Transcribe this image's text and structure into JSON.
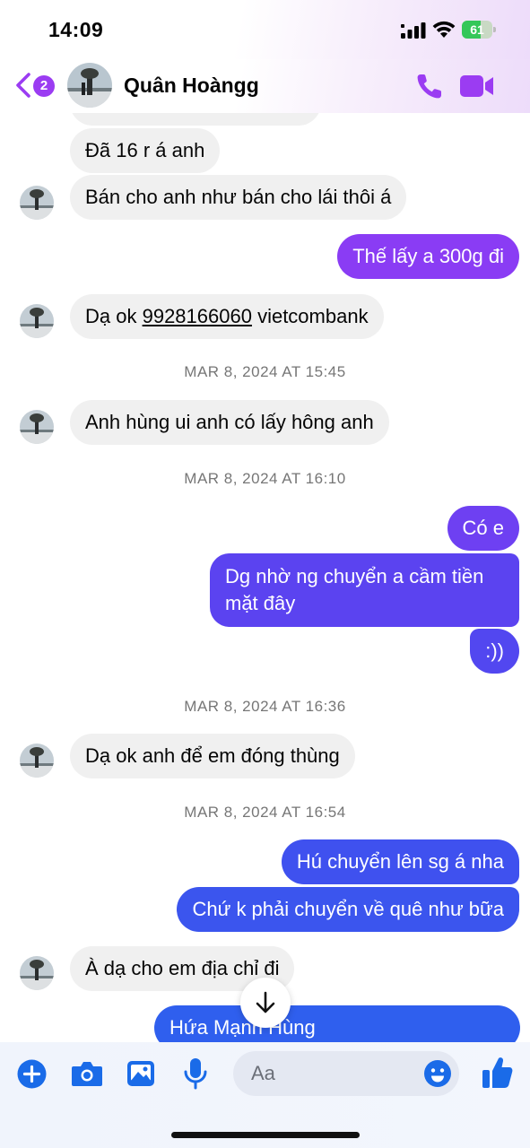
{
  "status_bar": {
    "time": "14:09",
    "battery": "61",
    "battery_level": 0.61
  },
  "header": {
    "unread_count": "2",
    "contact_name": "Quân Hoàngg"
  },
  "messages": [
    {
      "side": "in",
      "text": "Đã 16 r á anh"
    },
    {
      "side": "in",
      "text": "Bán cho anh như bán cho lái thôi á"
    },
    {
      "side": "out",
      "text": "Thế lấy a 300g đi"
    },
    {
      "side": "in",
      "text_before": "Dạ ok ",
      "link": "9928166060",
      "text_after": " vietcombank"
    },
    {
      "side": "ts",
      "text": "MAR 8, 2024 AT 15:45"
    },
    {
      "side": "in",
      "text": "Anh hùng ui anh có lấy hông anh"
    },
    {
      "side": "ts",
      "text": "MAR 8, 2024 AT 16:10"
    },
    {
      "side": "out",
      "text": "Có e"
    },
    {
      "side": "out",
      "text": "Dg nhờ ng chuyển a cầm tiền mặt đây"
    },
    {
      "side": "out",
      "text": ":))"
    },
    {
      "side": "ts",
      "text": "MAR 8, 2024 AT 16:36"
    },
    {
      "side": "in",
      "text": "Dạ ok anh để em đóng thùng"
    },
    {
      "side": "ts",
      "text": "MAR 8, 2024 AT 16:54"
    },
    {
      "side": "out",
      "text": "Hú chuyển lên sg á nha"
    },
    {
      "side": "out",
      "text": "Chứ k phải chuyển về quê như bữa"
    },
    {
      "side": "in",
      "text": "À dạ cho em địa chỉ đi"
    },
    {
      "side": "out",
      "text": "Hứa Mạnh Hùng"
    }
  ],
  "composer": {
    "placeholder": "Aa"
  },
  "icons": {
    "back": "chevron-left-icon",
    "call": "phone-icon",
    "video": "video-camera-icon",
    "add": "plus-circle-icon",
    "camera": "camera-icon",
    "gallery": "image-icon",
    "mic": "microphone-icon",
    "emoji": "smile-icon",
    "like": "thumbs-up-icon",
    "scroll": "arrow-down-icon"
  },
  "colors": {
    "accent": "#9b3cf2",
    "out_purple": "#8a3cf4",
    "out_indigo": "#5b43f0",
    "out_blue": "#3b55ee",
    "incoming": "#f0f0f0",
    "composer_blue": "#1a6be8"
  }
}
